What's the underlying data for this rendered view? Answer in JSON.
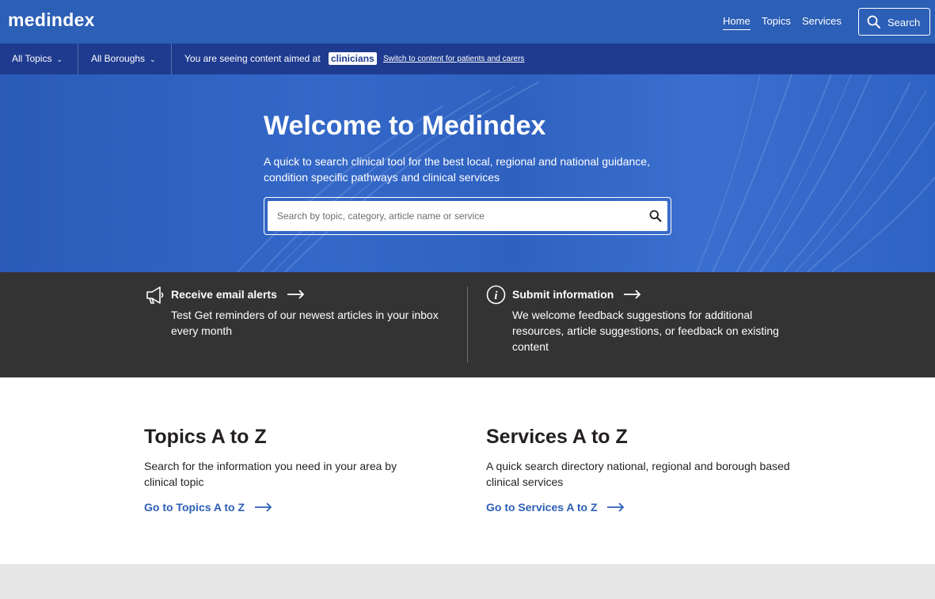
{
  "header": {
    "logo": "medindex",
    "nav": [
      {
        "label": "Home"
      },
      {
        "label": "Topics"
      },
      {
        "label": "Services"
      }
    ],
    "search_button": "Search",
    "brand_color": "#2c5fb6"
  },
  "filter_bar": {
    "topics_dropdown": "All Topics",
    "boroughs_dropdown": "All Boroughs",
    "audience_text": "You are seeing content aimed at",
    "audience_badge": "clinicians",
    "switch_link": "Switch to content for patients and carers",
    "bar_color": "#1f3b8f"
  },
  "hero": {
    "title": "Welcome to Medindex",
    "subtitle": "A quick to search clinical tool for the best local, regional and national guidance, condition specific pathways and clinical services",
    "search_placeholder": "Search by topic, category, article name or service",
    "search_value": ""
  },
  "info_band": {
    "email_alerts": {
      "title": "Receive email alerts",
      "text": "Test Get reminders of our newest articles in your inbox every month",
      "icon": "megaphone-icon"
    },
    "submit_info": {
      "title": "Submit information",
      "text": "We welcome feedback suggestions for additional resources, article suggestions, or feedback on existing content",
      "icon": "info-icon"
    },
    "band_color": "#333333"
  },
  "sections": {
    "topics": {
      "title": "Topics A to Z",
      "text": "Search for the information you need in your area by clinical topic",
      "link": "Go to Topics A to Z"
    },
    "services": {
      "title": "Services A to Z",
      "text": "A quick search directory national, regional and borough based clinical services",
      "link": "Go to Services A to Z"
    }
  }
}
